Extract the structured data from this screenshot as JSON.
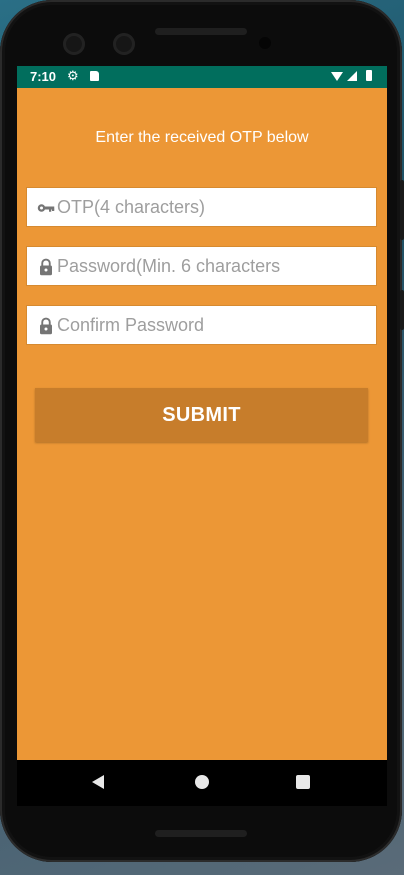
{
  "status_bar": {
    "time": "7:10",
    "icons": [
      "gear-icon",
      "sd-card-icon",
      "wifi-icon",
      "signal-icon",
      "battery-icon"
    ],
    "background_color": "#016E5D"
  },
  "screen": {
    "background_color": "#EC9736",
    "prompt": "Enter the received OTP below",
    "fields": [
      {
        "icon": "key-icon",
        "placeholder": "OTP(4 characters)",
        "value": ""
      },
      {
        "icon": "lock-icon",
        "placeholder": "Password(Min. 6 characters",
        "value": ""
      },
      {
        "icon": "lock-icon",
        "placeholder": "Confirm Password",
        "value": ""
      }
    ],
    "submit_label": "SUBMIT",
    "submit_color": "#C77D2B"
  },
  "nav_bar": {
    "buttons": [
      "back-icon",
      "home-icon",
      "recents-icon"
    ]
  }
}
